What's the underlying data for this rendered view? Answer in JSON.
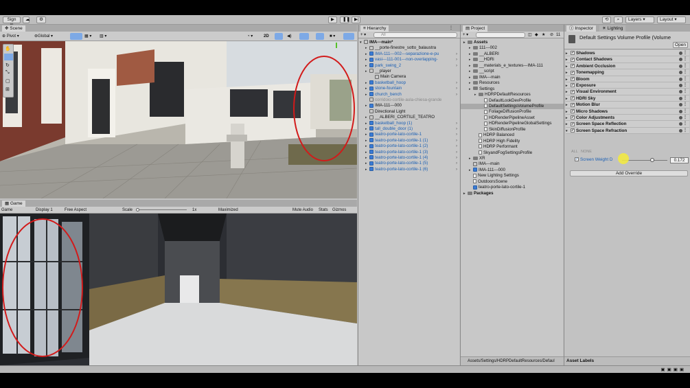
{
  "toolbar": {
    "sign_in": "Sign in",
    "layers_label": "Layers",
    "layout_label": "Layout"
  },
  "scene": {
    "tab": "Scene",
    "pivot": "Pivot",
    "global": "Global",
    "mode_2d": "2D"
  },
  "game": {
    "tab": "Game",
    "view_label": "Game",
    "display": "Display 1",
    "aspect": "Free Aspect",
    "scale_label": "Scale",
    "scale_value": "1x",
    "maximized": "Maximized",
    "mute_audio": "Mute Audio",
    "stats": "Stats",
    "gizmos": "Gizmos"
  },
  "hierarchy": {
    "tab": "Hierarchy",
    "search_placeholder": "All",
    "root": "IMA---main*",
    "items": [
      {
        "label": "__porte-finestre_sotto_balaustra",
        "style": "normal",
        "icon": "cube",
        "depth": 1,
        "arrow": true
      },
      {
        "label": "IMA-111---002---separazione-e-pu",
        "style": "blue",
        "icon": "prefab",
        "depth": 1,
        "arrow": true
      },
      {
        "label": "vasi---111-001---non-overlapping-",
        "style": "blue",
        "icon": "prefab",
        "depth": 1,
        "arrow": true
      },
      {
        "label": "park_swing_2",
        "style": "blue",
        "icon": "prefab",
        "depth": 1,
        "arrow": true
      },
      {
        "label": "__player",
        "style": "normal",
        "icon": "cube",
        "depth": 1,
        "arrow": true
      },
      {
        "label": "Main Camera",
        "style": "normal",
        "icon": "cube",
        "depth": 2,
        "arrow": false
      },
      {
        "label": "basketball_hoop",
        "style": "blue",
        "icon": "prefab",
        "depth": 1,
        "arrow": true
      },
      {
        "label": "stone-fountain",
        "style": "blue",
        "icon": "prefab",
        "depth": 1,
        "arrow": true
      },
      {
        "label": "church_bench",
        "style": "blue",
        "icon": "prefab",
        "depth": 1,
        "arrow": true
      },
      {
        "label": "corridoio-cortile-aula-chiesa-grande",
        "style": "gray",
        "icon": "cube",
        "depth": 1,
        "arrow": false
      },
      {
        "label": "IMA-111---000",
        "style": "normal",
        "icon": "prefab",
        "depth": 1,
        "arrow": true
      },
      {
        "label": "Directional Light",
        "style": "normal",
        "icon": "cube",
        "depth": 1,
        "arrow": false
      },
      {
        "label": "__ALBERI_CORTILE_TEATRO",
        "style": "normal",
        "icon": "cube",
        "depth": 1,
        "arrow": true
      },
      {
        "label": "basketball_hoop (1)",
        "style": "blue",
        "icon": "prefab",
        "depth": 1,
        "arrow": true
      },
      {
        "label": "tall_double_door (1)",
        "style": "blue",
        "icon": "prefab",
        "depth": 1,
        "arrow": true
      },
      {
        "label": "teatro-porte-lato-cortile-1",
        "style": "blue",
        "icon": "prefab",
        "depth": 1,
        "arrow": true
      },
      {
        "label": "teatro-porte-lato-cortile-1 (1)",
        "style": "blue",
        "icon": "prefab",
        "depth": 1,
        "arrow": true
      },
      {
        "label": "teatro-porte-lato-cortile-1 (2)",
        "style": "blue",
        "icon": "prefab",
        "depth": 1,
        "arrow": true
      },
      {
        "label": "teatro-porte-lato-cortile-1 (3)",
        "style": "blue",
        "icon": "prefab",
        "depth": 1,
        "arrow": true
      },
      {
        "label": "teatro-porte-lato-cortile-1 (4)",
        "style": "blue",
        "icon": "prefab",
        "depth": 1,
        "arrow": true
      },
      {
        "label": "teatro-porte-lato-cortile-1 (5)",
        "style": "blue",
        "icon": "prefab",
        "depth": 1,
        "arrow": true
      },
      {
        "label": "teatro-porte-lato-cortile-1 (6)",
        "style": "blue",
        "icon": "prefab",
        "depth": 1,
        "arrow": true
      }
    ]
  },
  "project": {
    "tab": "Project",
    "count": "11",
    "items": [
      {
        "label": "Assets",
        "icon": "folder",
        "depth": 0,
        "arrow": true,
        "bold": true
      },
      {
        "label": "111---002",
        "icon": "folder",
        "depth": 1,
        "arrow": true
      },
      {
        "label": "__ALBERI",
        "icon": "folder",
        "depth": 1,
        "arrow": true
      },
      {
        "label": "__HDRi",
        "icon": "folder",
        "depth": 1,
        "arrow": true
      },
      {
        "label": "__materials_e_textures---IMA-111",
        "icon": "folder",
        "depth": 1,
        "arrow": true
      },
      {
        "label": "__script",
        "icon": "folder",
        "depth": 1,
        "arrow": true
      },
      {
        "label": "IMA---main",
        "icon": "folder",
        "depth": 1,
        "arrow": true
      },
      {
        "label": "Resources",
        "icon": "folder",
        "depth": 1,
        "arrow": true
      },
      {
        "label": "Settings",
        "icon": "folder",
        "depth": 1,
        "arrow": true
      },
      {
        "label": "HDRPDefaultResources",
        "icon": "folder",
        "depth": 2,
        "arrow": true
      },
      {
        "label": "DefaultLookDevProfile",
        "icon": "file",
        "depth": 3,
        "arrow": false
      },
      {
        "label": "DefaultSettingsVolumeProfile",
        "icon": "file",
        "depth": 3,
        "arrow": false,
        "selected": true
      },
      {
        "label": "FoliageDiffusionProfile",
        "icon": "file",
        "depth": 3,
        "arrow": false
      },
      {
        "label": "HDRenderPipelineAsset",
        "icon": "file",
        "depth": 3,
        "arrow": false
      },
      {
        "label": "HDRenderPipelineGlobalSettings",
        "icon": "file",
        "depth": 3,
        "arrow": false
      },
      {
        "label": "SkinDiffusionProfile",
        "icon": "file",
        "depth": 3,
        "arrow": false
      },
      {
        "label": "HDRP Balanced",
        "icon": "file",
        "depth": 2,
        "arrow": false
      },
      {
        "label": "HDRP High Fidelity",
        "icon": "file",
        "depth": 2,
        "arrow": false
      },
      {
        "label": "HDRP Performant",
        "icon": "file",
        "depth": 2,
        "arrow": false
      },
      {
        "label": "SkyandFogSettingsProfile",
        "icon": "file",
        "depth": 2,
        "arrow": false
      },
      {
        "label": "XR",
        "icon": "folder",
        "depth": 1,
        "arrow": true
      },
      {
        "label": "IMA---main",
        "icon": "scene",
        "depth": 1,
        "arrow": false
      },
      {
        "label": "IMA-111---000",
        "icon": "prefab",
        "depth": 1,
        "arrow": true
      },
      {
        "label": "New Lighting Settings",
        "icon": "file",
        "depth": 1,
        "arrow": false
      },
      {
        "label": "OutdoorsScene",
        "icon": "file",
        "depth": 1,
        "arrow": false
      },
      {
        "label": "teatro-porte-lato-cortile-1",
        "icon": "prefab",
        "depth": 1,
        "arrow": false
      },
      {
        "label": "Packages",
        "icon": "folder",
        "depth": 0,
        "arrow": true,
        "bold": true
      }
    ],
    "footer_path": "Assets/Settings/HDRPDefaultResources/Defaul"
  },
  "inspector": {
    "tab": "Inspector",
    "lighting_tab": "Lighting",
    "title": "Default Settings Volume Profile (Volume",
    "open_button": "Open",
    "overrides": [
      "Shadows",
      "Contact Shadows",
      "Ambient Occlusion",
      "Tonemapping",
      "Bloom",
      "Exposure",
      "Visual Environment",
      "HDRI Sky",
      "Motion Blur",
      "Micro Shadows",
      "Color Adjustments",
      "Screen Space Reflection",
      "Screen Space Refraction"
    ],
    "all_label": "ALL",
    "none_label": "NONE",
    "param_label": "Screen Weight D",
    "param_value": "0.172",
    "param_fraction": 0.62,
    "add_override": "Add Override",
    "asset_labels": "Asset Labels"
  }
}
